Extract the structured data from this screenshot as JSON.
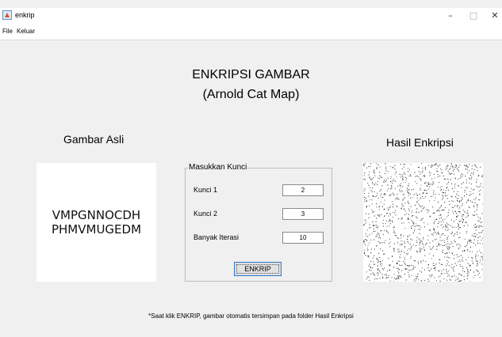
{
  "window": {
    "title": "enkrip",
    "minimize_glyph": "–",
    "maximize_glyph": "□",
    "close_glyph": "✕",
    "icon": "matlab-figure-icon"
  },
  "menu": {
    "items": [
      "File",
      "Keluar"
    ]
  },
  "main": {
    "title_line1": "ENKRIPSI GAMBAR",
    "title_line2": "(Arnold Cat Map)",
    "original_label": "Gambar Asli",
    "result_label": "Hasil Enkripsi",
    "original_image_text": [
      "VMPGNNOCDH",
      "PHMVMUGEDM"
    ]
  },
  "key_panel": {
    "title": "Masukkan Kunci",
    "fields": [
      {
        "label": "Kunci 1",
        "value": "2"
      },
      {
        "label": "Kunci 2",
        "value": "3"
      },
      {
        "label": "Banyak Iterasi",
        "value": "10"
      }
    ],
    "button_label": "ENKRIP"
  },
  "footer_note": "*Saat klik ENKRIP, gambar otomatis tersimpan pada folder Hasil Enkripsi",
  "colors": {
    "background": "#f0f0f0",
    "button_border": "#2f73c7"
  }
}
